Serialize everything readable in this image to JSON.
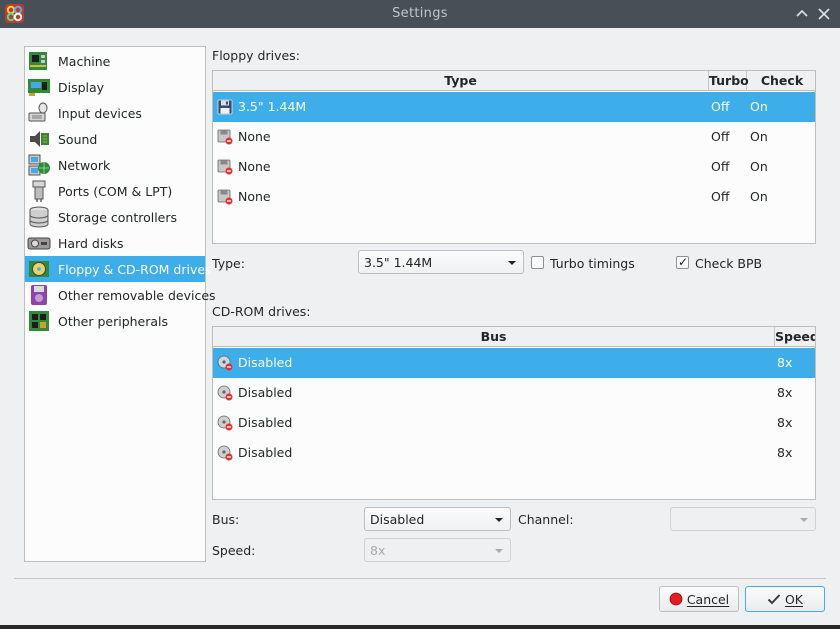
{
  "window": {
    "title": "Settings"
  },
  "colors": {
    "selection": "#3daee9",
    "titlebar": "#475057",
    "panel": "#eff0f1"
  },
  "sidebar": {
    "items": [
      {
        "label": "Machine",
        "icon": "machine-icon"
      },
      {
        "label": "Display",
        "icon": "display-icon"
      },
      {
        "label": "Input devices",
        "icon": "input-devices-icon"
      },
      {
        "label": "Sound",
        "icon": "sound-icon"
      },
      {
        "label": "Network",
        "icon": "network-icon"
      },
      {
        "label": "Ports (COM & LPT)",
        "icon": "ports-icon"
      },
      {
        "label": "Storage controllers",
        "icon": "storage-controllers-icon"
      },
      {
        "label": "Hard disks",
        "icon": "hard-disks-icon"
      },
      {
        "label": "Floppy & CD-ROM drives",
        "icon": "floppy-cdrom-icon",
        "selected": true
      },
      {
        "label": "Other removable devices",
        "icon": "removable-devices-icon"
      },
      {
        "label": "Other peripherals",
        "icon": "peripherals-icon"
      }
    ]
  },
  "floppy": {
    "section_label": "Floppy drives:",
    "columns": [
      "Type",
      "Turbo",
      "Check BPB"
    ],
    "rows": [
      {
        "type": "3.5\" 1.44M",
        "turbo": "Off",
        "check_bpb": "On",
        "selected": true,
        "icon": "floppy-disk-icon"
      },
      {
        "type": "None",
        "turbo": "Off",
        "check_bpb": "On",
        "icon": "floppy-disabled-icon"
      },
      {
        "type": "None",
        "turbo": "Off",
        "check_bpb": "On",
        "icon": "floppy-disabled-icon"
      },
      {
        "type": "None",
        "turbo": "Off",
        "check_bpb": "On",
        "icon": "floppy-disabled-icon"
      }
    ],
    "type_label": "Type:",
    "type_value": "3.5\" 1.44M",
    "turbo_label": "Turbo timings",
    "turbo_checked": false,
    "check_bpb_label": "Check BPB",
    "check_bpb_checked": true
  },
  "cdrom": {
    "section_label": "CD-ROM drives:",
    "columns": [
      "Bus",
      "Speed"
    ],
    "rows": [
      {
        "bus": "Disabled",
        "speed": "8x",
        "selected": true,
        "icon": "cdrom-disabled-icon"
      },
      {
        "bus": "Disabled",
        "speed": "8x",
        "icon": "cdrom-disabled-icon"
      },
      {
        "bus": "Disabled",
        "speed": "8x",
        "icon": "cdrom-disabled-icon"
      },
      {
        "bus": "Disabled",
        "speed": "8x",
        "icon": "cdrom-disabled-icon"
      }
    ],
    "bus_label": "Bus:",
    "bus_value": "Disabled",
    "channel_label": "Channel:",
    "channel_value": "",
    "speed_label": "Speed:",
    "speed_value": "8x"
  },
  "buttons": {
    "cancel": "Cancel",
    "ok": "OK"
  }
}
